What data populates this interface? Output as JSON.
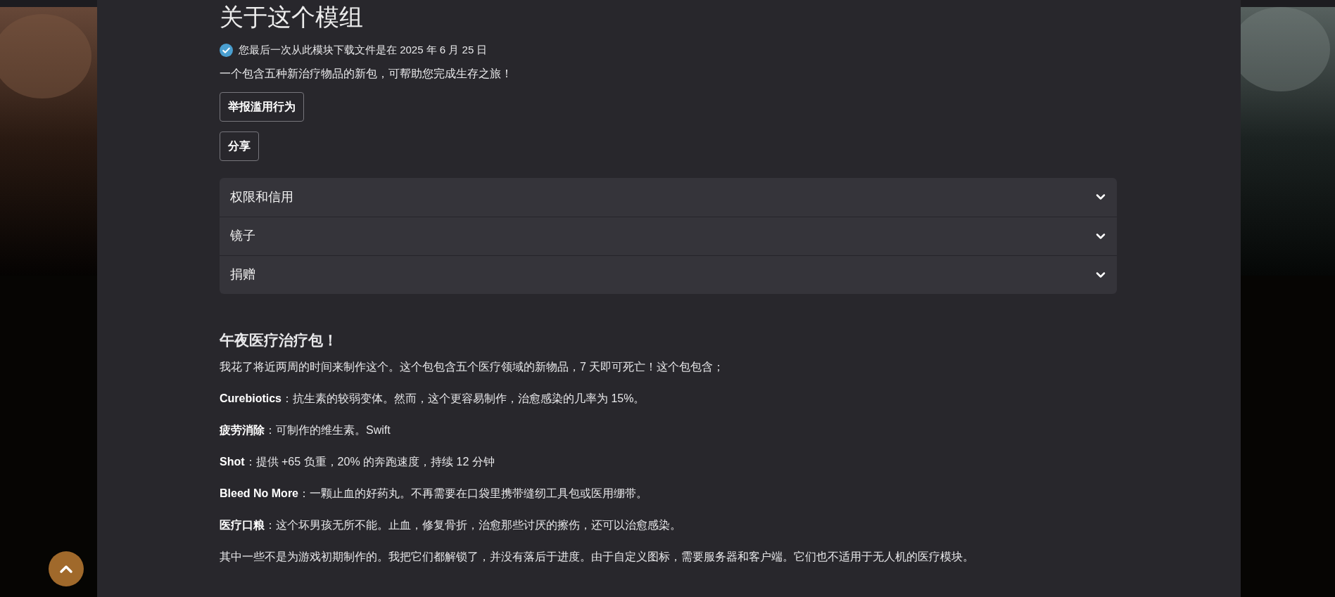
{
  "section_title": "关于这个模组",
  "download_notice": {
    "verified": true,
    "text": "您最后一次从此模块下载文件是在 2025 年 6 月 25 日"
  },
  "summary": "一个包含五种新治疗物品的新包，可帮助您完成生存之旅！",
  "actions": [
    "举报滥用行为",
    "分享"
  ],
  "accordion": [
    {
      "label": "权限和信用",
      "expanded": false
    },
    {
      "label": "镜子",
      "expanded": false
    },
    {
      "label": "捐赠",
      "expanded": false
    }
  ],
  "article": {
    "heading": "午夜医疗治疗包！",
    "paragraphs": [
      "我花了将近两周的时间来制作这个。这个包包含五个医疗领域的新物品，7 天即可死亡！这个包包含；",
      "**Curebiotics**：抗生素的较弱变体。然而，这个更容易制作，治愈感染的几率为 15%。",
      "**疲劳消除**：可制作的维生素。Swift",
      "**Shot**：提供 +65 负重，20% 的奔跑速度，持续 12 分钟",
      "**Bleed No More**：一颗止血的好药丸。不再需要在口袋里携带缝纫工具包或医用绷带。",
      "**医疗口粮**：这个坏男孩无所不能。止血，修复骨折，治愈那些讨厌的擦伤，还可以治愈感染。",
      "其中一些不是为游戏初期制作的。我把它们都解锁了，并没有落后于进度。由于自定义图标，需要服务器和客户端。它们也不适用于无人机的医疗模块。"
    ]
  }
}
